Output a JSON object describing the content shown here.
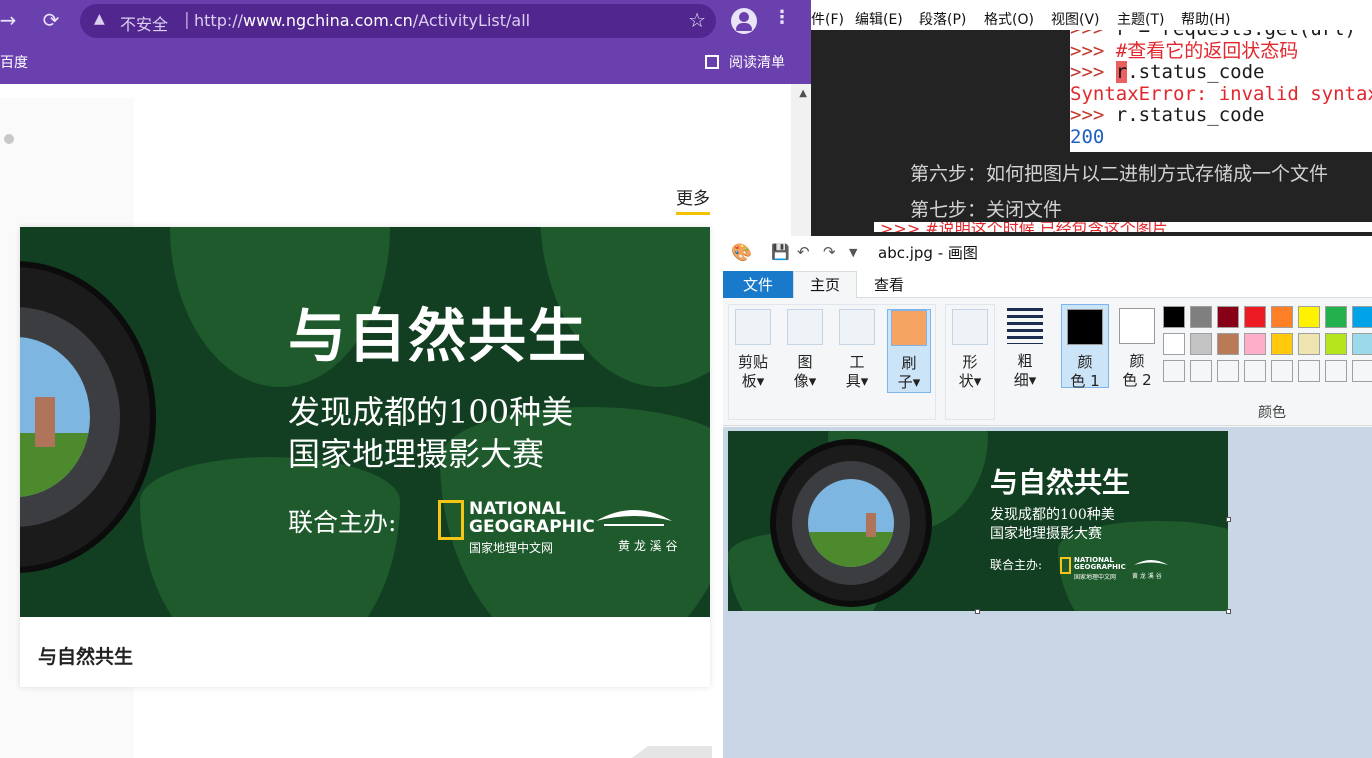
{
  "browser": {
    "insecure_label": "不安全",
    "url_prefix": "http://",
    "url_domain": "www.ngchina.com.cn",
    "url_path": "/ActivityList/all",
    "bookmark_left": "百度",
    "reading_list": "阅读清单",
    "more_link": "更多",
    "card_title": "与自然共生",
    "icons": [
      "forward-icon",
      "reload-icon",
      "warning-icon",
      "star-icon",
      "profile-icon",
      "menu-icon",
      "reading-list-icon"
    ]
  },
  "banner": {
    "main_title": "与自然共生",
    "line1": "发现成都的100种美",
    "line2": "国家地理摄影大赛",
    "cohost_label": "联合主办:",
    "ng_line1": "NATIONAL",
    "ng_line2": "GEOGRAPHIC",
    "ng_cn": "国家地理中文网",
    "huanglong": "黄 龙 溪 谷"
  },
  "editor": {
    "menu": [
      "件(F)",
      "编辑(E)",
      "段落(P)",
      "格式(O)",
      "视图(V)",
      "主题(T)",
      "帮助(H)"
    ],
    "code_lines": [
      {
        "prompt": ">>> ",
        "text": "r = requests.get(url)"
      },
      {
        "prompt": ">>> ",
        "text": "#查看它的返回状态码"
      },
      {
        "prompt": ">>> ",
        "text": "r.status_code"
      },
      {
        "prompt": "",
        "text": "SyntaxError: invalid syntax"
      },
      {
        "prompt": ">>> ",
        "text": "r.status_code"
      },
      {
        "prompt": "",
        "text": "200"
      }
    ],
    "overflow_comment": ">>> #说明这个时候 已经包含这个图片",
    "step6": "第六步：如何把图片以二进制方式存储成一个文件",
    "step7": "第七步：关闭文件"
  },
  "paint": {
    "title": "abc.jpg - 画图",
    "tab_file": "文件",
    "tab_home": "主页",
    "tab_view": "查看",
    "tools": [
      {
        "l1": "剪贴",
        "l2": "板"
      },
      {
        "l1": "图",
        "l2": "像"
      },
      {
        "l1": "工",
        "l2": "具"
      },
      {
        "l1": "刷",
        "l2": "子"
      },
      {
        "l1": "形",
        "l2": "状"
      },
      {
        "l1": "粗",
        "l2": "细"
      }
    ],
    "color1": {
      "l1": "颜",
      "l2": "色 1"
    },
    "color2": {
      "l1": "颜",
      "l2": "色 2"
    },
    "colors_label": "颜色",
    "palette_row1": [
      "#000000",
      "#7f7f7f",
      "#880015",
      "#ed1c24",
      "#ff7f27",
      "#fff200",
      "#22b14c",
      "#00a2e8"
    ],
    "palette_row2": [
      "#ffffff",
      "#c3c3c3",
      "#b97a57",
      "#ffaec9",
      "#ffc90e",
      "#efe4b0",
      "#b5e61d",
      "#99d9ea"
    ]
  }
}
